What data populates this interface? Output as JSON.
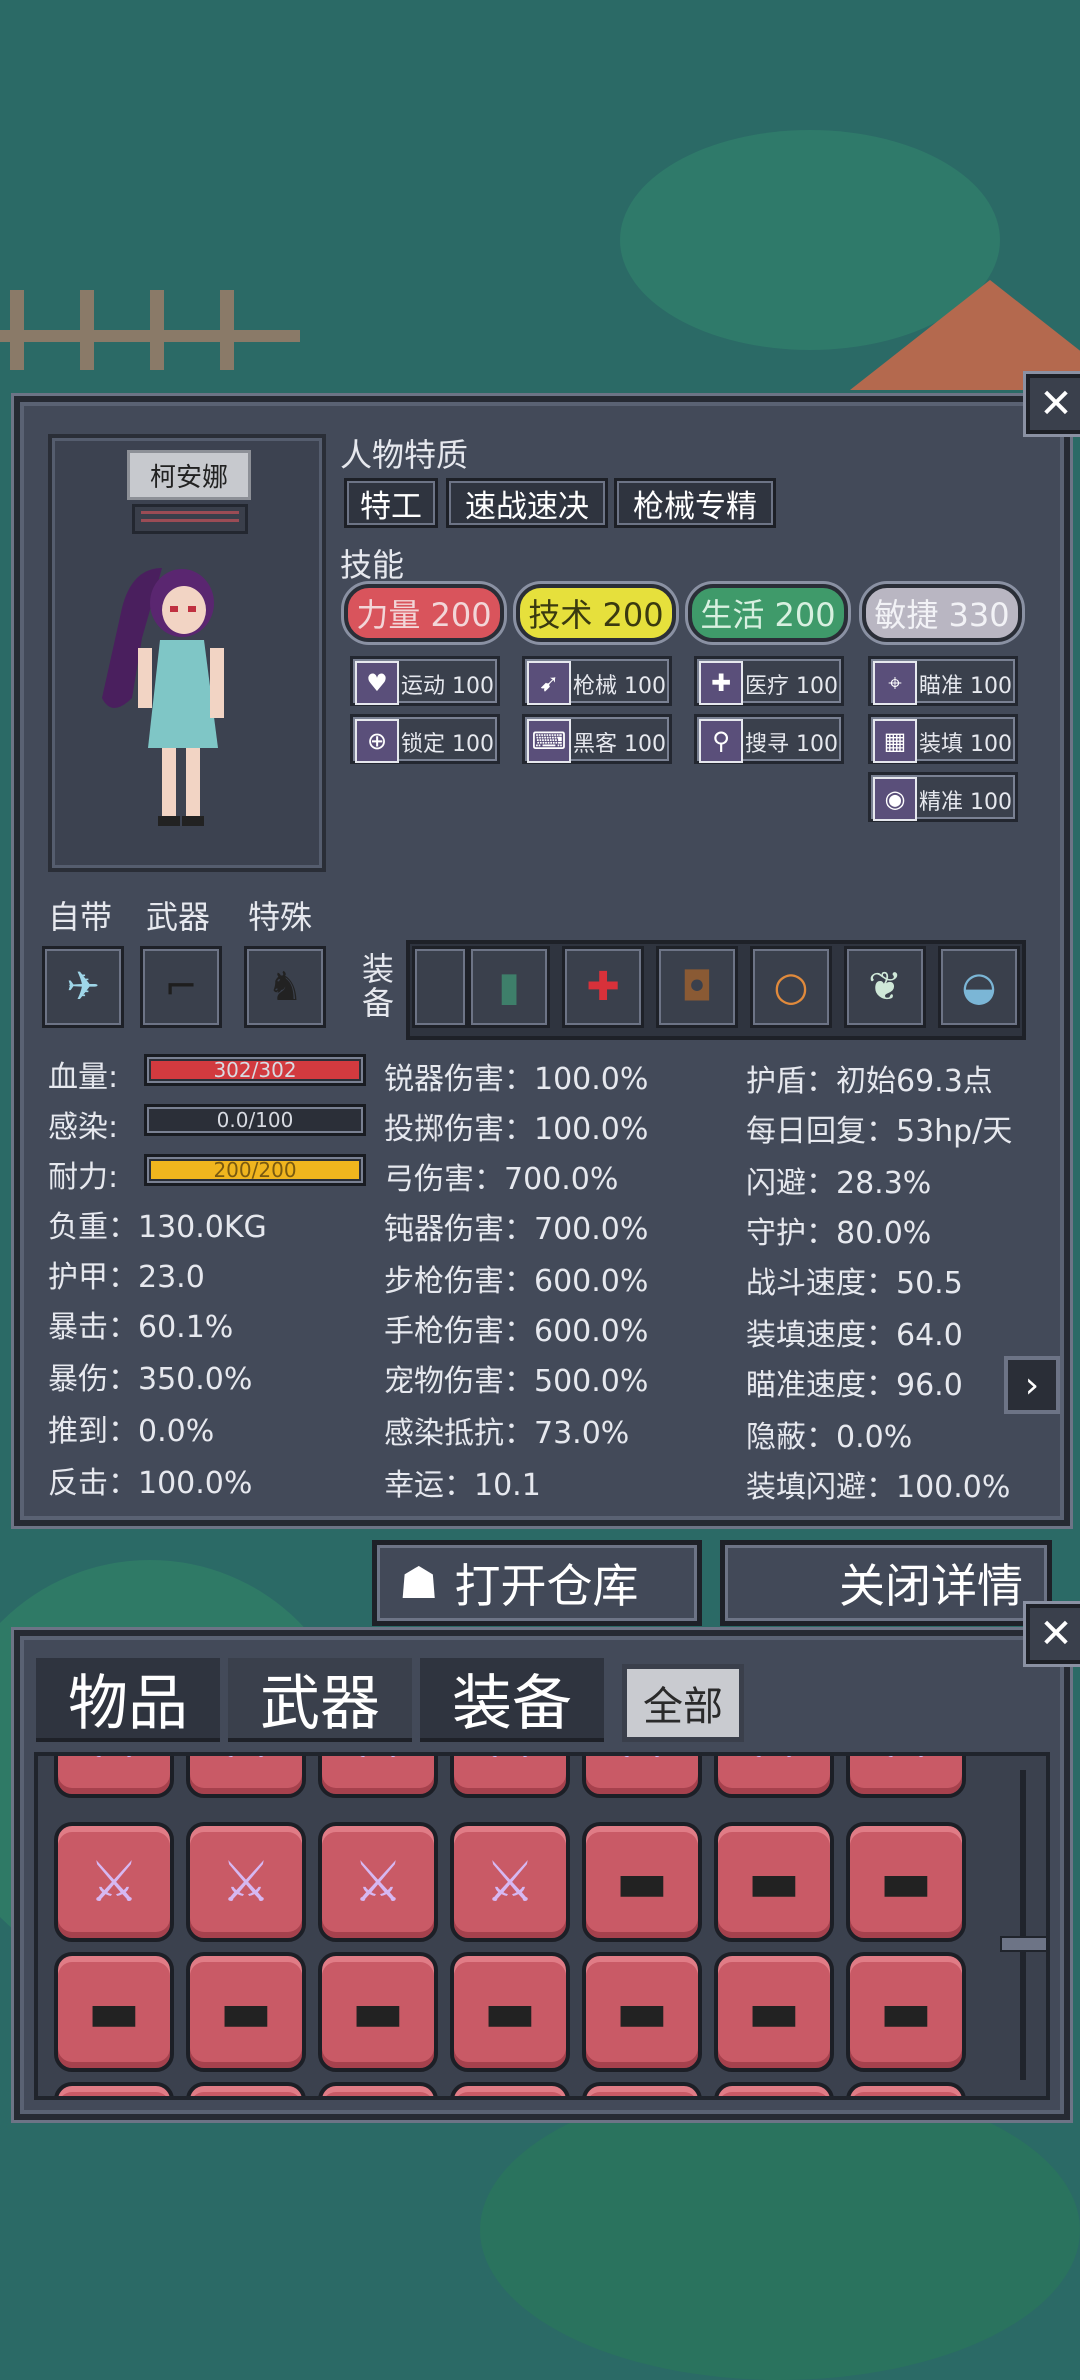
{
  "character": {
    "name": "柯安娜",
    "traits_title": "人物特质",
    "traits": [
      "特工",
      "速战速决",
      "枪械专精"
    ],
    "skills_title": "技能",
    "skills": [
      {
        "label": "力量 200",
        "color": "#d9545c",
        "text_color": "#f2d6d8"
      },
      {
        "label": "技术 200",
        "color": "#e6e03c",
        "text_color": "#3a3a10"
      },
      {
        "label": "生活 200",
        "color": "#3f9a6a",
        "text_color": "#d8f0e0"
      },
      {
        "label": "敏捷 330",
        "color": "#b9b6c2",
        "text_color": "#f2f2f6"
      }
    ],
    "sub_skills": [
      [
        {
          "label": "运动 100",
          "icon": "heart-icon",
          "glyph": "♥"
        },
        {
          "label": "锁定 100",
          "icon": "lock-icon",
          "glyph": "⊕"
        }
      ],
      [
        {
          "label": "枪械 100",
          "icon": "gun-icon",
          "glyph": "➹"
        },
        {
          "label": "黑客 100",
          "icon": "hack-icon",
          "glyph": "⌨"
        }
      ],
      [
        {
          "label": "医疗 100",
          "icon": "medkit-icon",
          "glyph": "✚"
        },
        {
          "label": "搜寻 100",
          "icon": "magnifier-icon",
          "glyph": "⚲"
        }
      ],
      [
        {
          "label": "瞄准 100",
          "icon": "crosshair-icon",
          "glyph": "⌖"
        },
        {
          "label": "装填 100",
          "icon": "magazine-icon",
          "glyph": "▦"
        },
        {
          "label": "精准 100",
          "icon": "eye-icon",
          "glyph": "◉"
        }
      ]
    ]
  },
  "loadout": {
    "labels": [
      "自带",
      "武器",
      "特殊"
    ],
    "equip_label": "装备"
  },
  "stats": {
    "bars": [
      {
        "label": "血量:",
        "value": "302/302",
        "fill": 1.0,
        "color": "#d23a3f"
      },
      {
        "label": "感染:",
        "value": "0.0/100",
        "fill": 0.0,
        "color": "#7b8090"
      },
      {
        "label": "耐力:",
        "value": "200/200",
        "fill": 1.0,
        "color": "#f0b51e"
      }
    ],
    "col1": [
      "负重：130.0KG",
      "护甲：23.0",
      "暴击：60.1%",
      "暴伤：350.0%",
      "推到：0.0%",
      "反击：100.0%"
    ],
    "col2": [
      "锐器伤害：100.0%",
      "投掷伤害：100.0%",
      "弓伤害：700.0%",
      "钝器伤害：700.0%",
      "步枪伤害：600.0%",
      "手枪伤害：600.0%",
      "宠物伤害：500.0%",
      "感染抵抗：73.0%",
      "幸运：10.1"
    ],
    "col3": [
      "护盾：初始69.3点",
      "每日回复：53hp/天",
      "闪避：28.3%",
      "守护：80.0%",
      "战斗速度：50.5",
      "装填速度：64.0",
      "瞄准速度：96.0",
      "隐蔽：0.0%",
      "装填闪避：100.0%"
    ]
  },
  "buttons": {
    "open_storage": "打开仓库",
    "close_details": "关闭详情"
  },
  "inventory": {
    "tabs": [
      "物品",
      "武器",
      "装备"
    ],
    "filter": "全部"
  }
}
